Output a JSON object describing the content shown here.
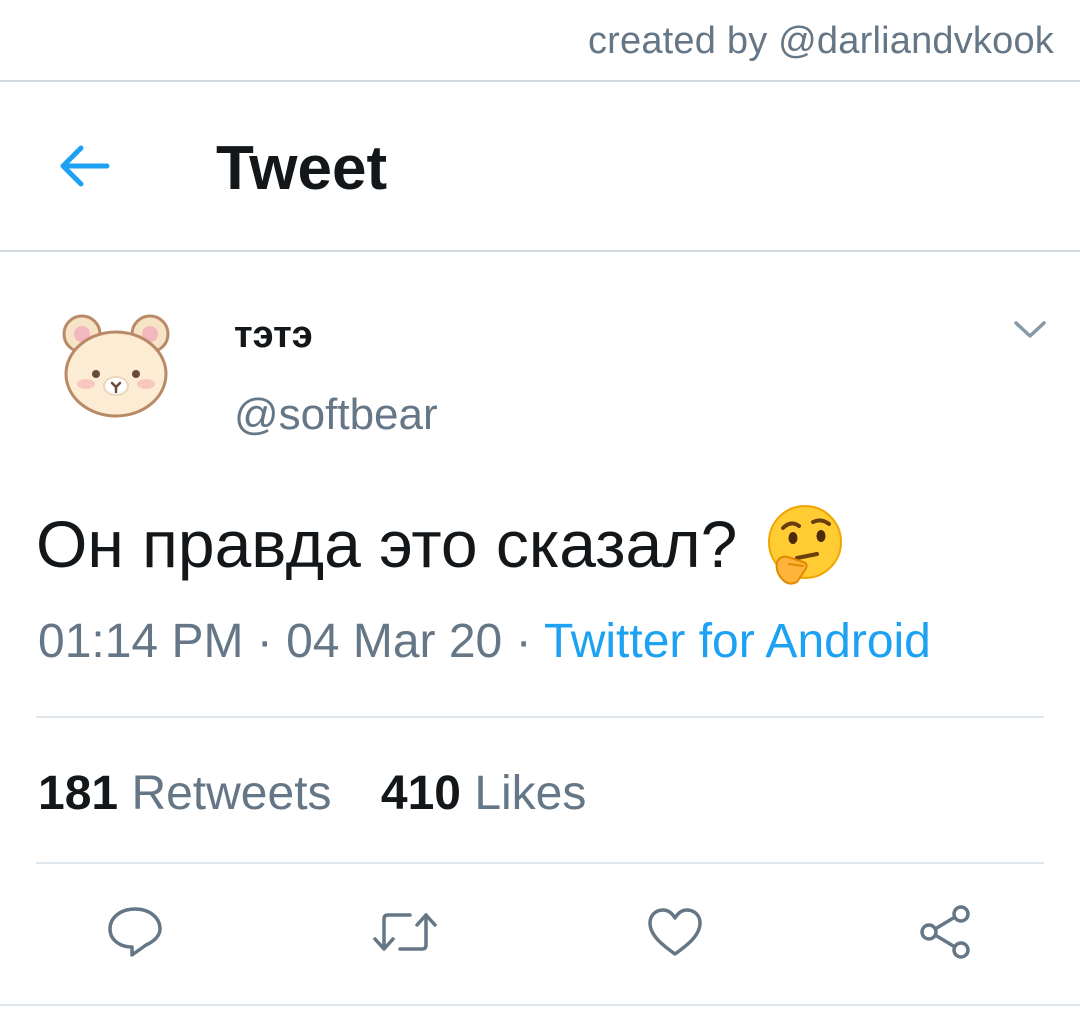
{
  "watermark": "created by @darliandvkook",
  "header": {
    "title": "Tweet",
    "back_icon": "arrow-left-icon"
  },
  "tweet": {
    "display_name": "тэтэ",
    "handle": "@softbear",
    "text": "Он правда это сказал?",
    "emoji": "thinking-face-emoji",
    "time": "01:14 PM",
    "separator": " · ",
    "date": "04 Mar 20",
    "source": "Twitter for Android",
    "retweets": {
      "count": "181",
      "label": "Retweets"
    },
    "likes": {
      "count": "410",
      "label": "Likes"
    }
  },
  "actions": [
    "reply-icon",
    "retweet-icon",
    "like-icon",
    "share-icon"
  ],
  "colors": {
    "accent": "#1da1f2",
    "text": "#14171a",
    "secondary": "#657786",
    "divider": "#e1e8ed"
  }
}
